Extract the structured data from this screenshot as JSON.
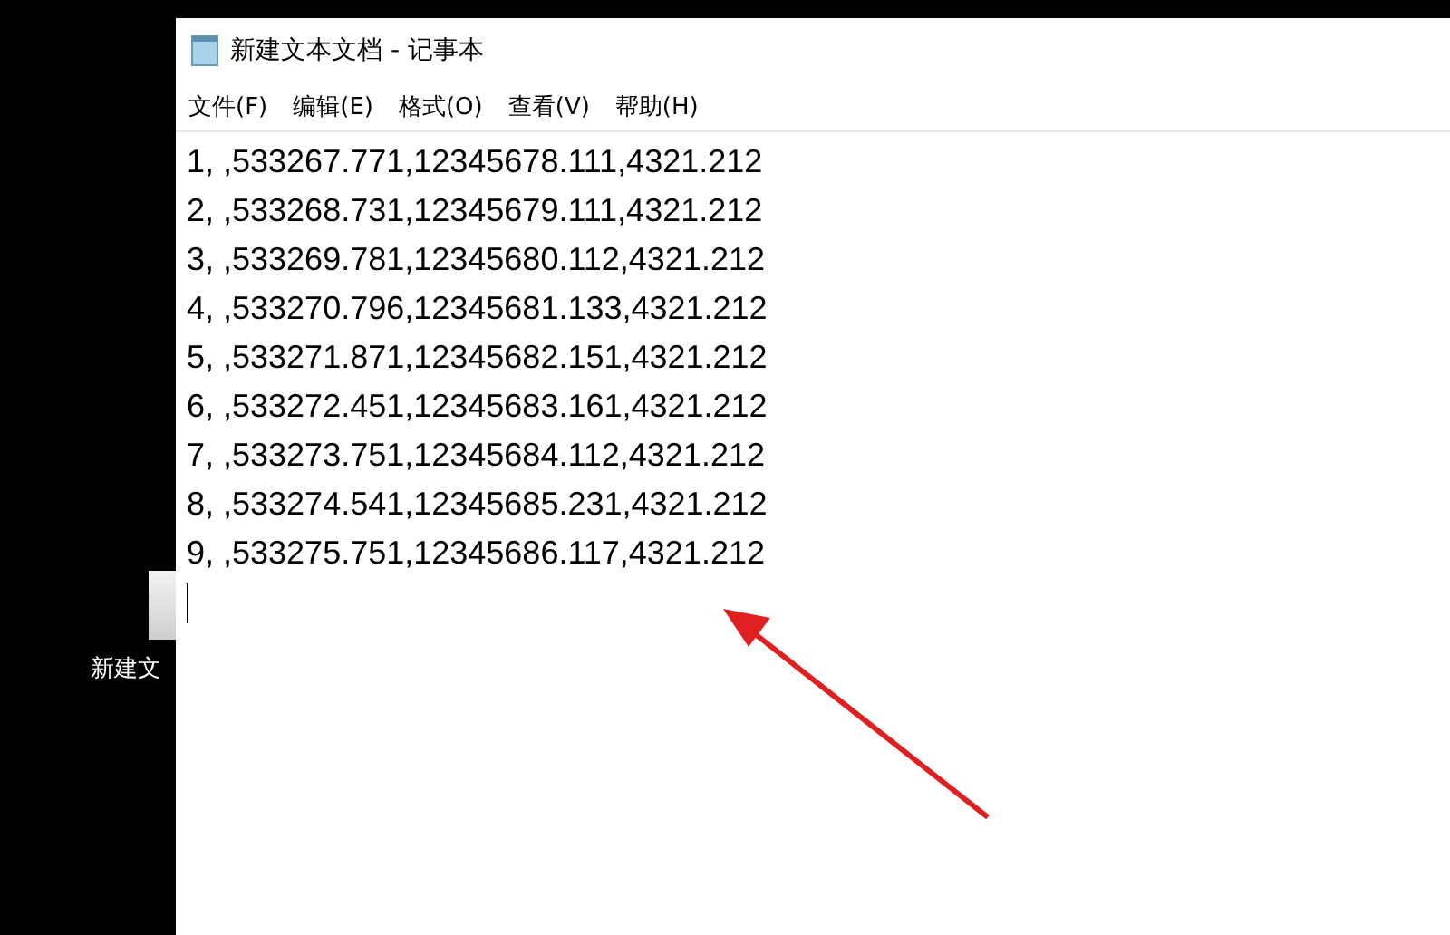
{
  "desktop": {
    "icon_label": "新建文"
  },
  "window": {
    "title": "新建文本文档 - 记事本"
  },
  "menu": [
    "文件(F)",
    "编辑(E)",
    "格式(O)",
    "查看(V)",
    "帮助(H)"
  ],
  "lines": [
    "1, ,533267.771,12345678.111,4321.212",
    "2, ,533268.731,12345679.111,4321.212",
    "3, ,533269.781,12345680.112,4321.212",
    "4, ,533270.796,12345681.133,4321.212",
    "5, ,533271.871,12345682.151,4321.212",
    "6, ,533272.451,12345683.161,4321.212",
    "7, ,533273.751,12345684.112,4321.212",
    "8, ,533274.541,12345685.231,4321.212",
    "9, ,533275.751,12345686.117,4321.212"
  ]
}
